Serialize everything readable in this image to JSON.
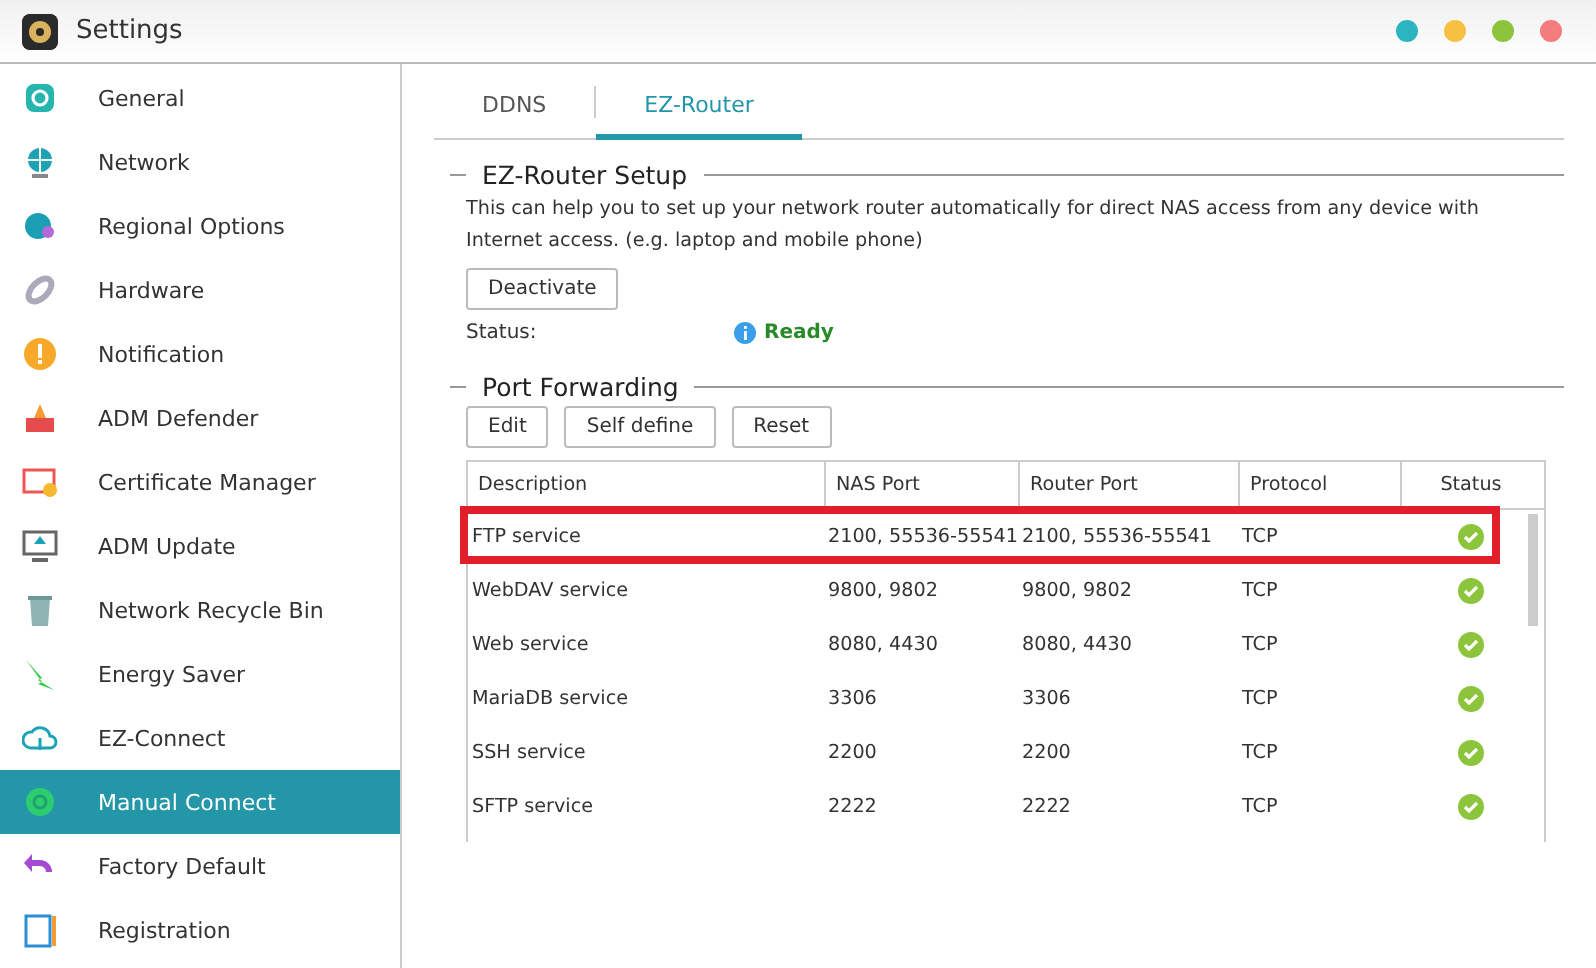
{
  "window": {
    "title": "Settings",
    "controls": [
      {
        "color": "#2bb5c0"
      },
      {
        "color": "#f6c142"
      },
      {
        "color": "#8cc43c"
      },
      {
        "color": "#f47c7c"
      }
    ]
  },
  "sidebar": {
    "items": [
      {
        "label": "General",
        "selected": false
      },
      {
        "label": "Network",
        "selected": false
      },
      {
        "label": "Regional Options",
        "selected": false
      },
      {
        "label": "Hardware",
        "selected": false
      },
      {
        "label": "Notification",
        "selected": false
      },
      {
        "label": "ADM Defender",
        "selected": false
      },
      {
        "label": "Certificate Manager",
        "selected": false
      },
      {
        "label": "ADM Update",
        "selected": false
      },
      {
        "label": "Network Recycle Bin",
        "selected": false
      },
      {
        "label": "Energy Saver",
        "selected": false
      },
      {
        "label": "EZ-Connect",
        "selected": false
      },
      {
        "label": "Manual Connect",
        "selected": true
      },
      {
        "label": "Factory Default",
        "selected": false
      },
      {
        "label": "Registration",
        "selected": false
      }
    ]
  },
  "tabs": [
    {
      "label": "DDNS",
      "selected": false
    },
    {
      "label": "EZ-Router",
      "selected": true
    }
  ],
  "setup": {
    "title": "EZ-Router Setup",
    "description": "This can help you to set up your network router automatically for direct NAS access from any device with Internet access. (e.g. laptop and mobile phone)",
    "button": "Deactivate",
    "status_label": "Status:",
    "status_value": "Ready"
  },
  "port_forwarding": {
    "title": "Port Forwarding",
    "buttons": [
      "Edit",
      "Self define",
      "Reset"
    ],
    "table": {
      "columns": [
        "Description",
        "NAS Port",
        "Router Port",
        "Protocol",
        "Status"
      ],
      "rows": [
        {
          "cells": [
            "FTP service",
            "2100, 55536-55541",
            "2100, 55536-55541",
            "TCP"
          ],
          "enabled": true,
          "highlighted": true
        },
        {
          "cells": [
            "WebDAV service",
            "9800, 9802",
            "9800, 9802",
            "TCP"
          ],
          "enabled": true,
          "highlighted": false
        },
        {
          "cells": [
            "Web service",
            "8080, 4430",
            "8080, 4430",
            "TCP"
          ],
          "enabled": true,
          "highlighted": false
        },
        {
          "cells": [
            "MariaDB service",
            "3306",
            "3306",
            "TCP"
          ],
          "enabled": true,
          "highlighted": false
        },
        {
          "cells": [
            "SSH service",
            "2200",
            "2200",
            "TCP"
          ],
          "enabled": true,
          "highlighted": false
        },
        {
          "cells": [
            "SFTP service",
            "2222",
            "2222",
            "TCP"
          ],
          "enabled": true,
          "highlighted": false
        }
      ]
    }
  }
}
